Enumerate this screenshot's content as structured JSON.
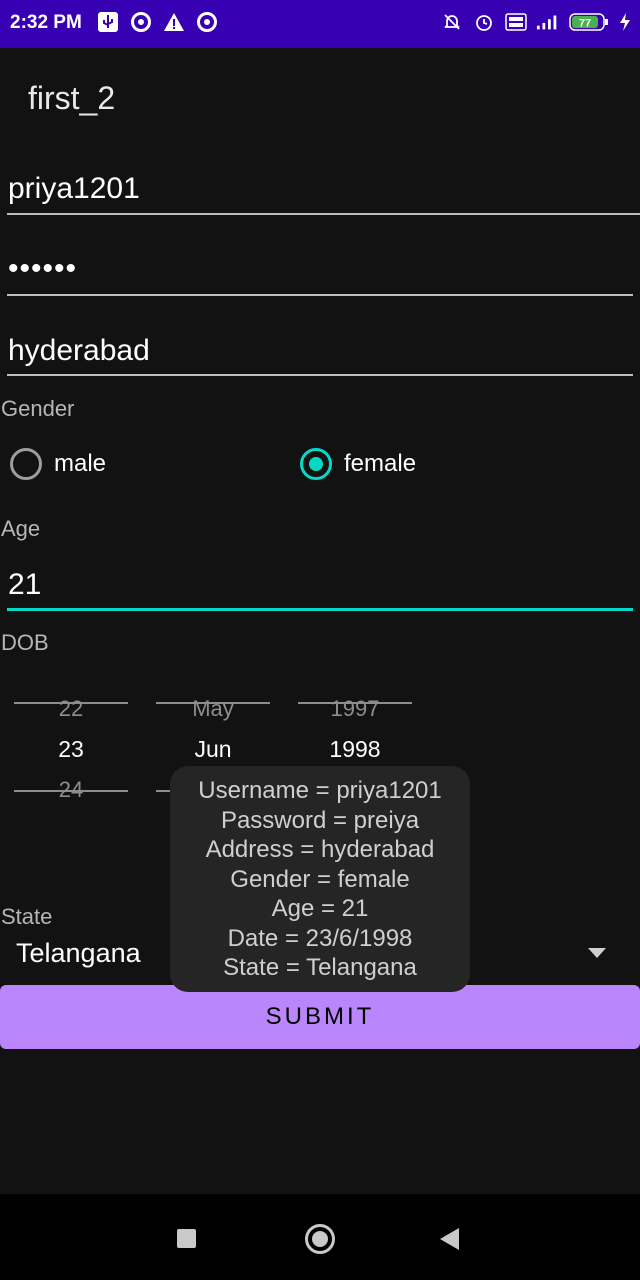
{
  "status_bar": {
    "time": "2:32 PM",
    "battery": "77",
    "left_icons": [
      "usb-icon",
      "circle-a-icon",
      "warning-icon",
      "circle-a-icon"
    ],
    "right_icons": [
      "bell-off-icon",
      "alarm-icon",
      "volte-icon",
      "signal-icon",
      "battery-icon",
      "charging-icon"
    ]
  },
  "app": {
    "title": "first_2"
  },
  "form": {
    "username": "priya1201",
    "password_masked": "••••••",
    "address": "hyderabad",
    "gender_label": "Gender",
    "gender_options": [
      "male",
      "female"
    ],
    "gender_selected": "female",
    "age_label": "Age",
    "age_value": "21",
    "dob_label": "DOB",
    "date_picker": {
      "day": {
        "prev": "22",
        "selected": "23",
        "next": "24"
      },
      "month": {
        "prev": "May",
        "selected": "Jun"
      },
      "year": {
        "prev": "1997",
        "selected": "1998"
      }
    },
    "state_label": "State",
    "state_value": "Telangana",
    "submit_label": "SUBMIT"
  },
  "toast": {
    "lines": [
      "Username = priya1201",
      "Password = preiya",
      "Address = hyderabad",
      "Gender = female",
      "Age = 21",
      "Date = 23/6/1998",
      "State = Telangana"
    ]
  },
  "colors": {
    "status_bar": "#3700b3",
    "background": "#121212",
    "accent": "#03dac5",
    "button": "#bb86fc"
  },
  "nav_bar": {
    "icons": [
      "recents-icon",
      "home-icon",
      "back-icon"
    ]
  }
}
